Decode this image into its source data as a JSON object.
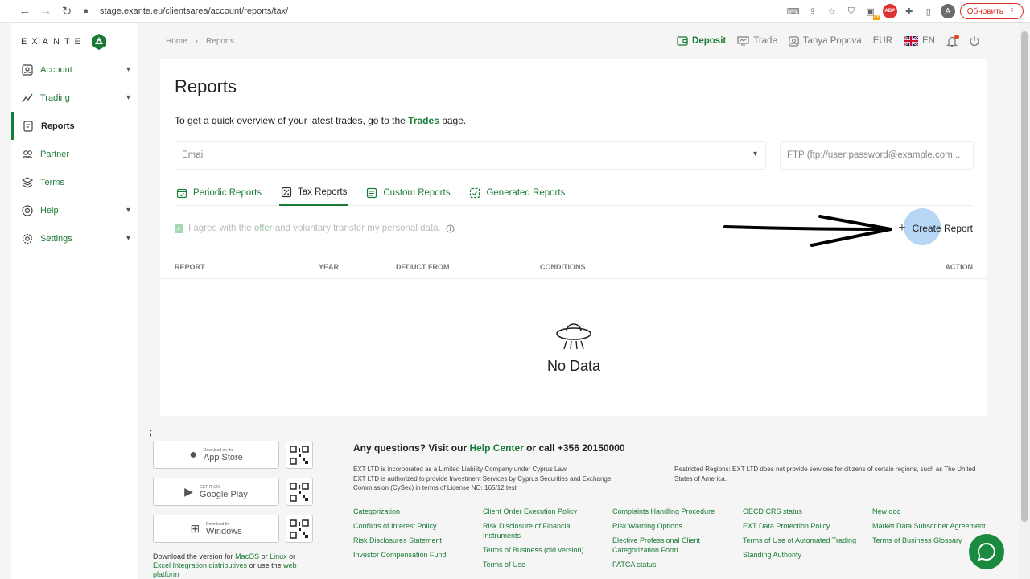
{
  "browser": {
    "url": "stage.exante.eu/clientsarea/account/reports/tax/",
    "update_label": "Обновить",
    "avatar_letter": "A",
    "abp_label": "ABP",
    "off_badge": "off"
  },
  "brand": {
    "name": "EXANTE",
    "accent": "#1a7a38"
  },
  "sidebar": {
    "items": [
      {
        "label": "Account",
        "icon": "account-icon",
        "chevron": true
      },
      {
        "label": "Trading",
        "icon": "trading-icon",
        "chevron": true
      },
      {
        "label": "Reports",
        "icon": "reports-icon",
        "chevron": false,
        "active": true
      },
      {
        "label": "Partner",
        "icon": "partner-icon",
        "chevron": false
      },
      {
        "label": "Terms",
        "icon": "terms-icon",
        "chevron": false
      },
      {
        "label": "Help",
        "icon": "help-icon",
        "chevron": true
      },
      {
        "label": "Settings",
        "icon": "settings-icon",
        "chevron": true
      }
    ]
  },
  "breadcrumb": {
    "home": "Home",
    "sep": "›",
    "current": "Reports"
  },
  "header": {
    "deposit": "Deposit",
    "trade": "Trade",
    "user": "Tanya Popova",
    "currency": "EUR",
    "language": "EN"
  },
  "main": {
    "title": "Reports",
    "subtitle_pre": "To get a quick overview of your latest trades, go to the ",
    "subtitle_link": "Trades",
    "subtitle_post": " page.",
    "email_placeholder": "Email",
    "ftp_placeholder": "FTP (ftp://user:password@example.com...",
    "tabs": [
      {
        "label": "Periodic Reports",
        "icon": "calendar-icon"
      },
      {
        "label": "Tax Reports",
        "icon": "tax-icon",
        "active": true
      },
      {
        "label": "Custom Reports",
        "icon": "custom-report-icon"
      },
      {
        "label": "Generated Reports",
        "icon": "generated-report-icon"
      }
    ],
    "agree_pre": "I agree with the ",
    "agree_link": "offer",
    "agree_post": " and voluntary transfer my personal data.",
    "create_label": "Create Report",
    "plus": "+",
    "columns": {
      "report": "REPORT",
      "year": "YEAR",
      "deduct": "DEDUCT FROM",
      "conditions": "CONDITIONS",
      "action": "ACTION"
    },
    "empty_text": "No Data"
  },
  "footer": {
    "semicolon": ";",
    "stores": [
      {
        "small": "Download on the",
        "big": "App Store"
      },
      {
        "small": "GET IT ON",
        "big": "Google Play"
      },
      {
        "small": "Download for",
        "big": "Windows"
      }
    ],
    "download": {
      "t1": "Download the version for ",
      "macos": "MacOS",
      "t2": " or ",
      "linux": "Linux",
      "t3": " or ",
      "excel": "Excel Integration distributives",
      "t4": " or use the ",
      "web": "web platform"
    },
    "question_pre": "Any questions? Visit our ",
    "question_link": "Help Center",
    "question_post": " or call +356 20150000",
    "legal_1": "EXT LTD is incorporated as a Limited Liability Company under Cyprus Law.",
    "legal_2": "EXT LTD is authorized to provide Investment Services by Cyprus Securities and Exchange",
    "legal_3": "Commission (CySec) in terms of License NO: 165/12 test_",
    "restricted": "Restricted Regions: EXT LTD does not provide services for citizens of certain regions, such as The United States of America.",
    "link_cols": [
      [
        "Categorization",
        "Conflicts of Interest Policy",
        "Risk Disclosures Statement",
        "Investor Compensation Fund"
      ],
      [
        "Client Order Execution Policy",
        "Risk Disclosure of Financial Instruments",
        "Terms of Business (old version)",
        "Terms of Use"
      ],
      [
        "Complaints Handling Procedure",
        "Risk Warning Options",
        "Elective Professional Client Categorization Form",
        "FATCA status"
      ],
      [
        "OECD CRS status",
        "EXT Data Protection Policy",
        "Terms of Use of Automated Trading",
        "Standing Authority"
      ],
      [
        "New doc",
        "Market Data Subscriber Agreement",
        "Terms of Business Glossary"
      ]
    ]
  }
}
